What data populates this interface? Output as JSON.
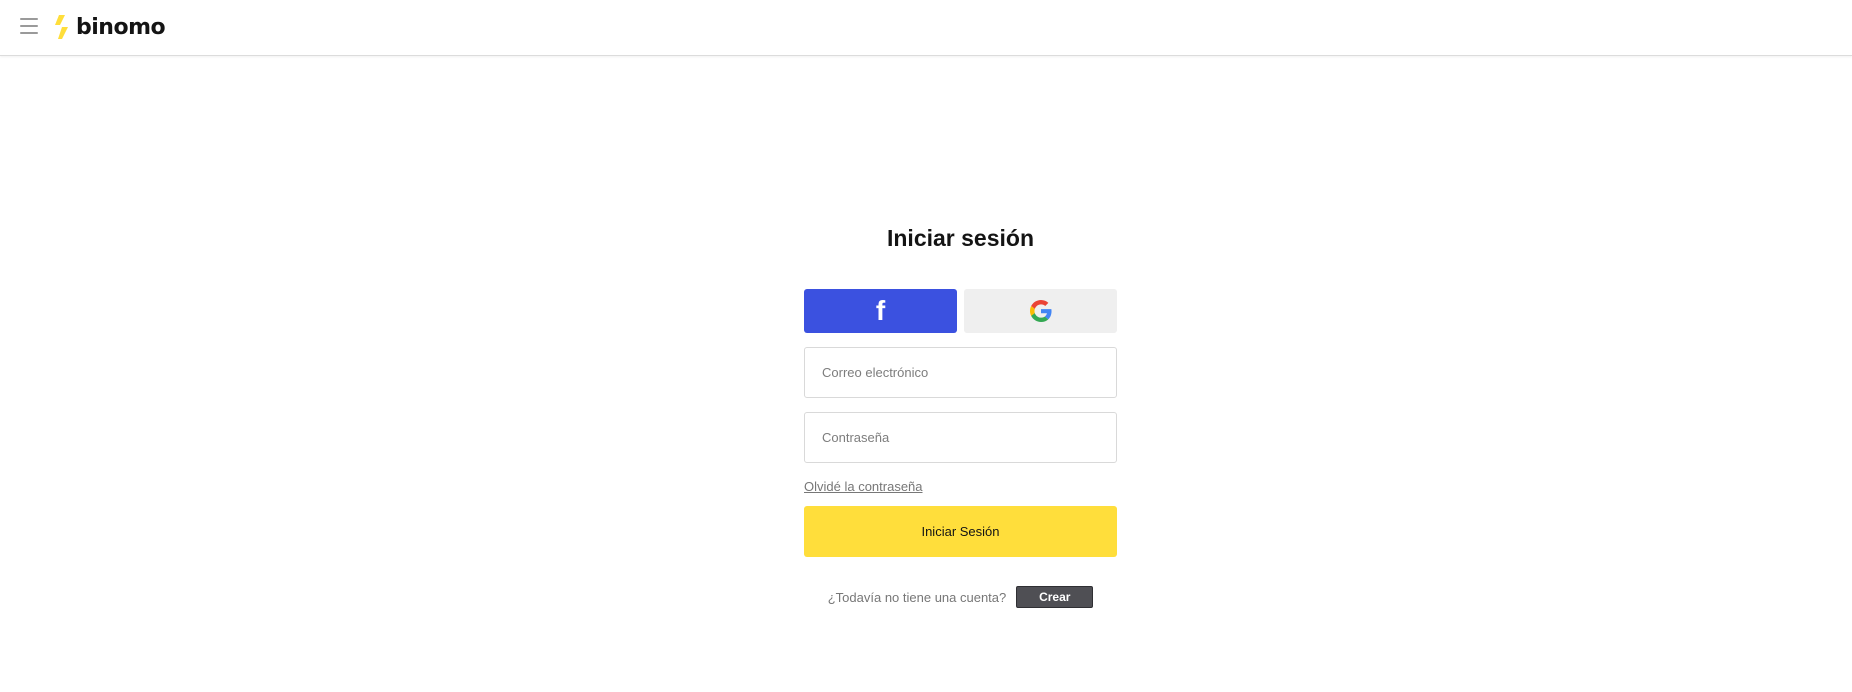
{
  "header": {
    "menu_icon": "hamburger-menu-icon",
    "logo_text": "binomo",
    "logo_mark_icon": "lightning-bolt-icon",
    "brand_color": "#ffde3b"
  },
  "login": {
    "title": "Iniciar sesión",
    "facebook": {
      "icon": "facebook-icon",
      "glyph": "f",
      "color": "#3b51e0"
    },
    "google": {
      "icon": "google-icon",
      "color": "#efefef"
    },
    "email_placeholder": "Correo electrónico",
    "password_placeholder": "Contraseña",
    "forgot_label": "Olvidé la contraseña",
    "submit_label": "Iniciar Sesión",
    "signup_prompt": "¿Todavía no tiene una cuenta?",
    "create_label": "Crear"
  }
}
